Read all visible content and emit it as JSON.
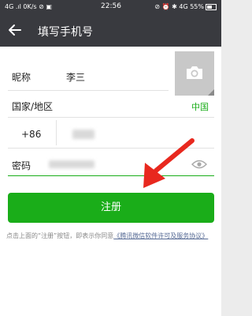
{
  "status_bar": {
    "left": "4G .ıl 0K/s ⊘ ▣",
    "time": "22:56",
    "right": "⊘ ⏰ ✱ 4G 55%"
  },
  "header": {
    "title": "填写手机号"
  },
  "form": {
    "nickname_label": "昵称",
    "nickname_value": "李三",
    "country_label": "国家/地区",
    "country_value": "中国",
    "phone_code": "+86",
    "password_label": "密码"
  },
  "register_button": "注册",
  "terms": {
    "prefix": "点击上面的“注册”按钮，即表示你同意",
    "link": "《腾讯微信软件许可及服务协议》"
  },
  "colors": {
    "accent": "#1aad19",
    "topbar": "#393a3f",
    "arrow": "#e8281e",
    "link": "#576b95"
  },
  "icons": [
    "back-arrow-icon",
    "camera-icon",
    "eye-icon",
    "red-arrow-annotation"
  ]
}
